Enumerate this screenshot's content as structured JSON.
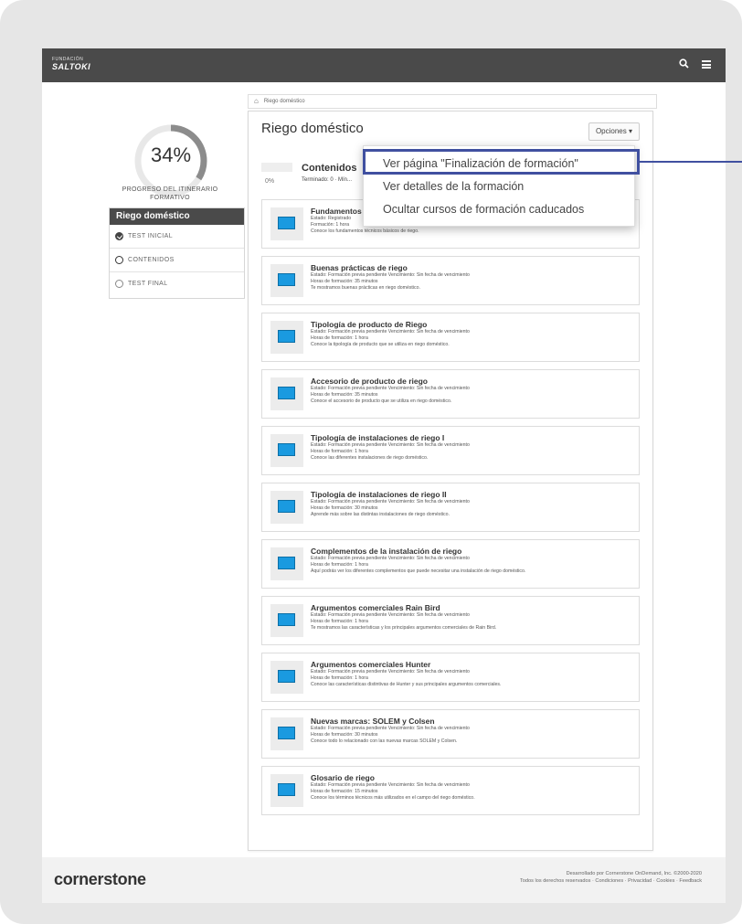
{
  "app": {
    "logo_top": "FUNDACIÓN",
    "logo_brand": "SALTOKI",
    "top_icons": [
      "search-icon",
      "menu-icon"
    ]
  },
  "sidebar": {
    "progress_value": "34%",
    "progress_fraction": 0.34,
    "progress_label": "PROGRESO DEL ITINERARIO FORMATIVO",
    "itinerary_title": "Riego doméstico",
    "items": [
      {
        "label": "TEST INICIAL",
        "status": "done"
      },
      {
        "label": "CONTENIDOS",
        "status": "current"
      },
      {
        "label": "TEST FINAL",
        "status": "pending"
      }
    ]
  },
  "breadcrumb": {
    "items": [
      "Riego doméstico"
    ]
  },
  "main": {
    "title": "Riego doméstico",
    "options_label": "Opciones ▾",
    "contents": {
      "percent": "0%",
      "title": "Contenidos",
      "summary": "Terminado: 0 · Mín..."
    },
    "courses": [
      {
        "title": "Fundamentos y",
        "line1": "Estado: Registrado",
        "line2": "Formación: 1 hora",
        "line3": "Conoce los fundamentos técnicos básicos de riego."
      },
      {
        "title": "Buenas prácticas de riego",
        "line1": "Estado: Formación previa pendiente   Vencimiento: Sin fecha de vencimiento",
        "line2": "Horas de formación: 35 minutos",
        "line3": "Te mostramos buenas prácticas en riego doméstico."
      },
      {
        "title": "Tipología de producto de Riego",
        "line1": "Estado: Formación previa pendiente   Vencimiento: Sin fecha de vencimiento",
        "line2": "Horas de formación: 1 hora",
        "line3": "Conoce la tipología de producto que se utiliza en riego doméstico."
      },
      {
        "title": "Accesorio de producto de riego",
        "line1": "Estado: Formación previa pendiente   Vencimiento: Sin fecha de vencimiento",
        "line2": "Horas de formación: 35 minutos",
        "line3": "Conoce el accesorio de producto que se utiliza en riego doméstico."
      },
      {
        "title": "Tipología de instalaciones de riego I",
        "line1": "Estado: Formación previa pendiente   Vencimiento: Sin fecha de vencimiento",
        "line2": "Horas de formación: 1 hora",
        "line3": "Conoce las diferentes instalaciones de riego doméstico."
      },
      {
        "title": "Tipología de instalaciones de riego II",
        "line1": "Estado: Formación previa pendiente   Vencimiento: Sin fecha de vencimiento",
        "line2": "Horas de formación: 30 minutos",
        "line3": "Aprende más sobre las distintas instalaciones de riego doméstico."
      },
      {
        "title": "Complementos de la instalación de riego",
        "line1": "Estado: Formación previa pendiente   Vencimiento: Sin fecha de vencimiento",
        "line2": "Horas de formación: 1 hora",
        "line3": "Aquí podrás ver los diferentes complementos que puede necesitar una instalación de riego doméstico."
      },
      {
        "title": "Argumentos comerciales Rain Bird",
        "line1": "Estado: Formación previa pendiente   Vencimiento: Sin fecha de vencimiento",
        "line2": "Horas de formación: 1 hora",
        "line3": "Te mostramos las características y los principales argumentos comerciales de Rain Bird."
      },
      {
        "title": "Argumentos comerciales Hunter",
        "line1": "Estado: Formación previa pendiente   Vencimiento: Sin fecha de vencimiento",
        "line2": "Horas de formación: 1 hora",
        "line3": "Conoce las características distintivas de Hunter y sus principales argumentos comerciales."
      },
      {
        "title": "Nuevas marcas: SOLEM y Colsen",
        "line1": "Estado: Formación previa pendiente   Vencimiento: Sin fecha de vencimiento",
        "line2": "Horas de formación: 30 minutos",
        "line3": "Conoce todo lo relacionado con las nuevas marcas SOLEM y Colsen."
      },
      {
        "title": "Glosario de riego",
        "line1": "Estado: Formación previa pendiente   Vencimiento: Sin fecha de vencimiento",
        "line2": "Horas de formación: 15 minutos",
        "line3": "Conoce los términos técnicos más utilizados en el campo del riego doméstico."
      }
    ]
  },
  "dropdown": {
    "items": [
      "Ver página \"Finalización de formación\"",
      "Ver detalles de la formación",
      "Ocultar cursos de formación caducados"
    ]
  },
  "footer": {
    "brand": "cornerstone",
    "line1": "Desarrollado por Cornerstone OnDemand, Inc. ©2000-2020",
    "line2": "Todos los derechos reservados · Condiciones · Privacidad · Cookies · Feedback"
  },
  "colors": {
    "topbar": "#4a4a4a",
    "accent_highlight": "#4050a0",
    "thumbnail": "#1a9ae0"
  }
}
